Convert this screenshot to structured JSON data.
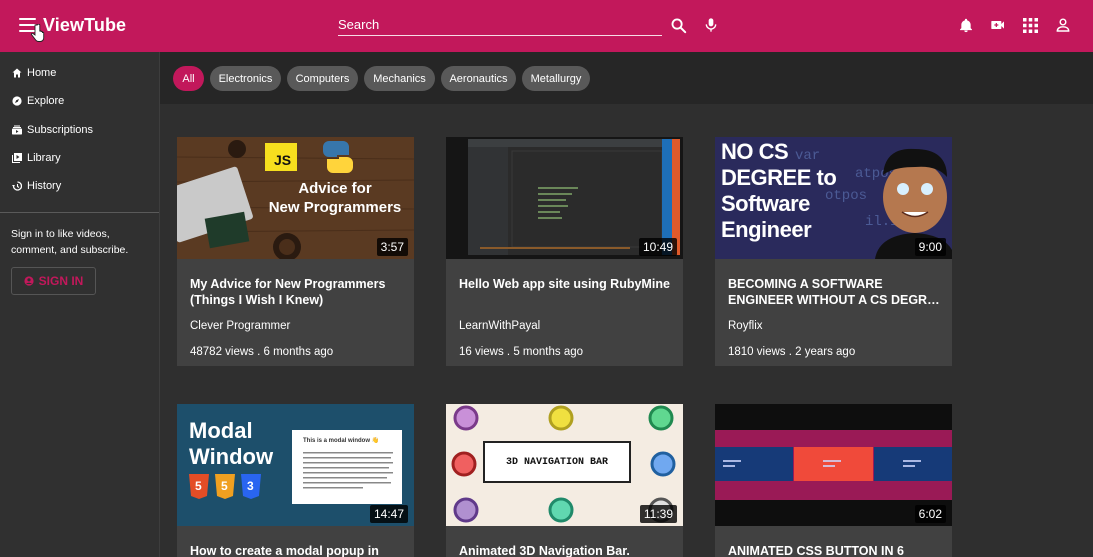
{
  "app": {
    "logo": "ViewTube"
  },
  "search": {
    "placeholder": "Search"
  },
  "sidebar": {
    "items": [
      {
        "label": "Home",
        "icon": "home-icon"
      },
      {
        "label": "Explore",
        "icon": "compass-icon"
      },
      {
        "label": "Subscriptions",
        "icon": "subscriptions-icon"
      },
      {
        "label": "Library",
        "icon": "library-icon"
      },
      {
        "label": "History",
        "icon": "history-icon"
      }
    ],
    "signin_prompt": "Sign in to like videos, comment, and subscribe.",
    "signin_button": "SIGN IN"
  },
  "chips": [
    "All",
    "Electronics",
    "Computers",
    "Mechanics",
    "Aeronautics",
    "Metallurgy"
  ],
  "videos": [
    {
      "title": "My Advice for New Programmers (Things I Wish I Knew)",
      "channel": "Clever Programmer",
      "meta": "48782 views . 6 months ago",
      "duration": "3:57",
      "thumb_line1": "Advice for",
      "thumb_line2": "New Programmers",
      "thumb_badge": "JS"
    },
    {
      "title": "Hello Web app site using RubyMine",
      "channel": "LearnWithPayal",
      "meta": "16 views . 5 months ago",
      "duration": "10:49"
    },
    {
      "title": "BECOMING A SOFTWARE ENGINEER WITHOUT A CS DEGR…",
      "channel": "Royflix",
      "meta": "1810 views . 2 years ago",
      "duration": "9:00",
      "thumb_lines": [
        "NO CS",
        "DEGREE to",
        "Software",
        "Engineer"
      ]
    },
    {
      "title": "How to create a modal popup in",
      "duration": "14:47",
      "thumb_lines": [
        "Modal",
        "Window"
      ],
      "thumb_popup_title": "This is a modal window 👋"
    },
    {
      "title": "Animated 3D Navigation Bar.",
      "duration": "11:39",
      "thumb_text": "3D NAVIGATION BAR"
    },
    {
      "title": "ANIMATED CSS BUTTON IN 6",
      "duration": "6:02"
    }
  ],
  "colors": {
    "brand": "#c2185b",
    "background": "#2f2f2f",
    "card": "#414141",
    "chip": "#595959"
  }
}
